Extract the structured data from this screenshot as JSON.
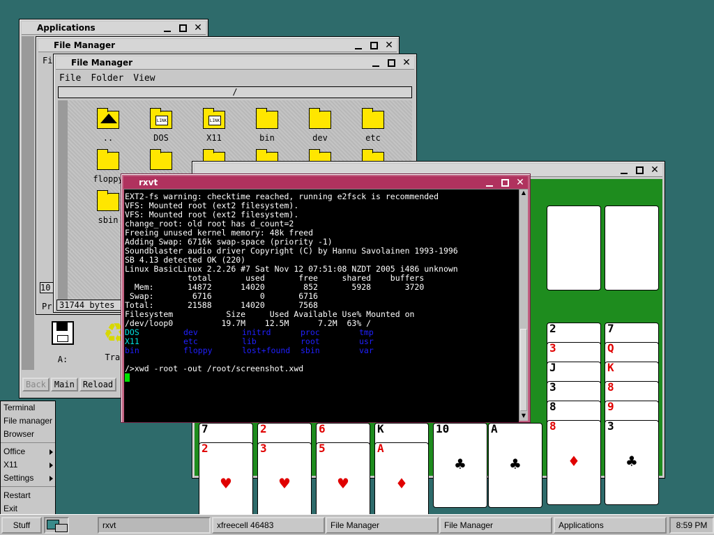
{
  "windows": {
    "applications": {
      "title": "Applications"
    },
    "fm_back": {
      "title": "File Manager",
      "menu_stub": "Fi"
    },
    "fm_front": {
      "title": "File Manager",
      "menu": [
        "File",
        "Folder",
        "View"
      ],
      "path": "/",
      "folders": [
        {
          "label": "..",
          "type": "up"
        },
        {
          "label": "DOS",
          "type": "link"
        },
        {
          "label": "X11",
          "type": "link"
        },
        {
          "label": "bin",
          "type": "folder"
        },
        {
          "label": "dev",
          "type": "folder"
        },
        {
          "label": "etc",
          "type": "folder"
        },
        {
          "label": "floppy",
          "type": "folder"
        },
        {
          "label": "",
          "type": "folder"
        },
        {
          "label": "",
          "type": "folder"
        },
        {
          "label": "",
          "type": "folder"
        },
        {
          "label": "",
          "type": "folder"
        },
        {
          "label": "",
          "type": "folder"
        },
        {
          "label": "sbin",
          "type": "folder"
        }
      ],
      "status": "31744 bytes i",
      "size_stub": "10",
      "pr_stub": "Pr"
    },
    "apps_bottom": {
      "drive_label": "A:",
      "trash_label": "Tras",
      "buttons": [
        "Back",
        "Main",
        "Reload"
      ]
    },
    "rxvt": {
      "title": "rxvt",
      "lines": [
        "EXT2-fs warning: checktime reached, running e2fsck is recommended",
        "VFS: Mounted root (ext2 filesystem).",
        "VFS: Mounted root (ext2 filesystem).",
        "change_root: old root has d_count=2",
        "Freeing unused kernel memory: 48k freed",
        "Adding Swap: 6716k swap-space (priority -1)",
        "Soundblaster audio driver Copyright (C) by Hannu Savolainen 1993-1996",
        "SB 4.13 detected OK (220)",
        "",
        "Linux BasicLinux 2.2.26 #7 Sat Nov 12 07:51:08 NZDT 2005 i486 unknown",
        "",
        "             total       used       free     shared    buffers",
        "  Mem:       14872      14020        852       5928       3720",
        " Swap:        6716          0       6716",
        "Total:       21588      14020       7568",
        "",
        "Filesystem           Size     Used Available Use% Mounted on",
        "/dev/loop0          19.7M    12.5M      7.2M  63% /",
        ""
      ],
      "ls_rows": [
        [
          {
            "t": "DOS",
            "c": "cy"
          },
          {
            "t": "dev",
            "c": "bl"
          },
          {
            "t": "initrd",
            "c": "bl"
          },
          {
            "t": "proc",
            "c": "bl"
          },
          {
            "t": "tmp",
            "c": "bl"
          }
        ],
        [
          {
            "t": "X11",
            "c": "cy"
          },
          {
            "t": "etc",
            "c": "bl"
          },
          {
            "t": "lib",
            "c": "bl"
          },
          {
            "t": "root",
            "c": "bl"
          },
          {
            "t": "usr",
            "c": "bl"
          }
        ],
        [
          {
            "t": "bin",
            "c": "bl"
          },
          {
            "t": "floppy",
            "c": "bl"
          },
          {
            "t": "lost+found",
            "c": "bl"
          },
          {
            "t": "sbin",
            "c": "bl"
          },
          {
            "t": "var",
            "c": "bl"
          }
        ]
      ],
      "command": "/>xwd -root -out /root/screenshot.xwd"
    },
    "freecell": {
      "title": ""
    }
  },
  "cards": {
    "foundation": [
      {
        "suit": "♦",
        "color": "red"
      },
      {
        "suit": "♣",
        "color": "blk"
      }
    ],
    "columns": [
      {
        "ranks": [
          "2",
          "3",
          "J",
          "3",
          "8",
          "8"
        ],
        "colors": [
          "blk",
          "red",
          "blk",
          "blk",
          "blk",
          "red"
        ],
        "bottom": "♦",
        "bcolor": "red"
      },
      {
        "ranks": [
          "7",
          "Q",
          "K",
          "8",
          "9",
          "3"
        ],
        "colors": [
          "blk",
          "red",
          "red",
          "red",
          "red",
          "blk"
        ],
        "bottom": "♣",
        "bcolor": "blk"
      }
    ],
    "lower": [
      {
        "ranks": [
          "7",
          "2"
        ],
        "colors": [
          "blk",
          "red"
        ],
        "suit": "♥"
      },
      {
        "ranks": [
          "2",
          "3"
        ],
        "colors": [
          "red",
          "red"
        ],
        "suit": "♥"
      },
      {
        "ranks": [
          "6",
          "5"
        ],
        "colors": [
          "red",
          "red"
        ],
        "suit": "♥"
      },
      {
        "ranks": [
          "K",
          "A"
        ],
        "colors": [
          "blk",
          "red"
        ],
        "suit": "♦"
      },
      {
        "ranks": [
          "10"
        ],
        "colors": [
          "blk"
        ],
        "suit": "♣"
      },
      {
        "ranks": [
          "A"
        ],
        "colors": [
          "blk"
        ],
        "suit": "♣"
      }
    ]
  },
  "start_menu": {
    "items": [
      "Terminal",
      "File manager",
      "Browser",
      "Office",
      "X11",
      "Settings",
      "Restart",
      "Exit"
    ]
  },
  "taskbar": {
    "start": "Stuff",
    "tasks": [
      "rxvt",
      "xfreecell 46483",
      "File Manager",
      "File Manager",
      "Applications"
    ],
    "clock": "8:59 PM"
  }
}
